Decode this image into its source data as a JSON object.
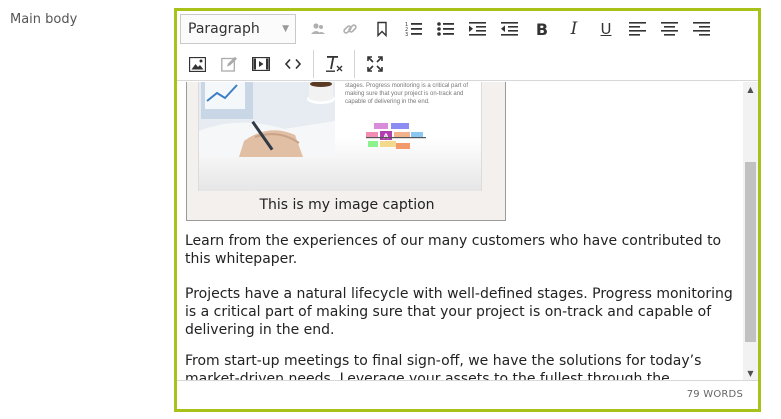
{
  "field": {
    "label": "Main body"
  },
  "toolbar": {
    "format_select": "Paragraph",
    "row1_buttons": [
      {
        "icon": "anchor-person-icon",
        "enabled": false
      },
      {
        "icon": "link-icon",
        "enabled": false
      },
      {
        "icon": "bookmark-icon",
        "enabled": true
      },
      {
        "icon": "numbered-list-icon",
        "enabled": true
      },
      {
        "icon": "bullet-list-icon",
        "enabled": true
      },
      {
        "icon": "indent-icon",
        "enabled": true
      },
      {
        "icon": "outdent-icon",
        "enabled": true
      },
      {
        "icon": "bold-icon",
        "enabled": true,
        "glyph": "B"
      },
      {
        "icon": "italic-icon",
        "enabled": true,
        "glyph": "I"
      },
      {
        "icon": "underline-icon",
        "enabled": true,
        "glyph": "U"
      },
      {
        "icon": "align-left-icon",
        "enabled": true
      },
      {
        "icon": "align-center-icon",
        "enabled": true
      },
      {
        "icon": "align-right-icon",
        "enabled": true
      }
    ],
    "row2_buttons": [
      {
        "icon": "insert-image-icon"
      },
      {
        "icon": "edit-icon"
      },
      {
        "icon": "insert-video-icon"
      },
      {
        "icon": "source-code-icon"
      },
      {
        "icon": "clear-formatting-icon"
      },
      {
        "icon": "fullscreen-icon"
      }
    ]
  },
  "content": {
    "figure": {
      "image_text": "stages. Progress monitoring is a critical part of making sure that your project is on-track and capable of delivering in the end.",
      "caption": "This is my image caption"
    },
    "paragraphs": [
      "Learn from the experiences of our many customers who have contributed to this whitepaper.",
      "Projects have a natural lifecycle with well-defined stages. Progress monitoring is a critical part of making sure that your project is on-track and capable of delivering in the end.",
      "From start-up meetings to final sign-off, we have the solutions for today’s market-driven needs. Leverage your assets to the fullest through the"
    ]
  },
  "status": {
    "word_count": "79 WORDS"
  },
  "colors": {
    "editor_border": "#a8c21a",
    "toolbar_icon": "#333333",
    "disabled_icon": "#b0b0b0"
  }
}
